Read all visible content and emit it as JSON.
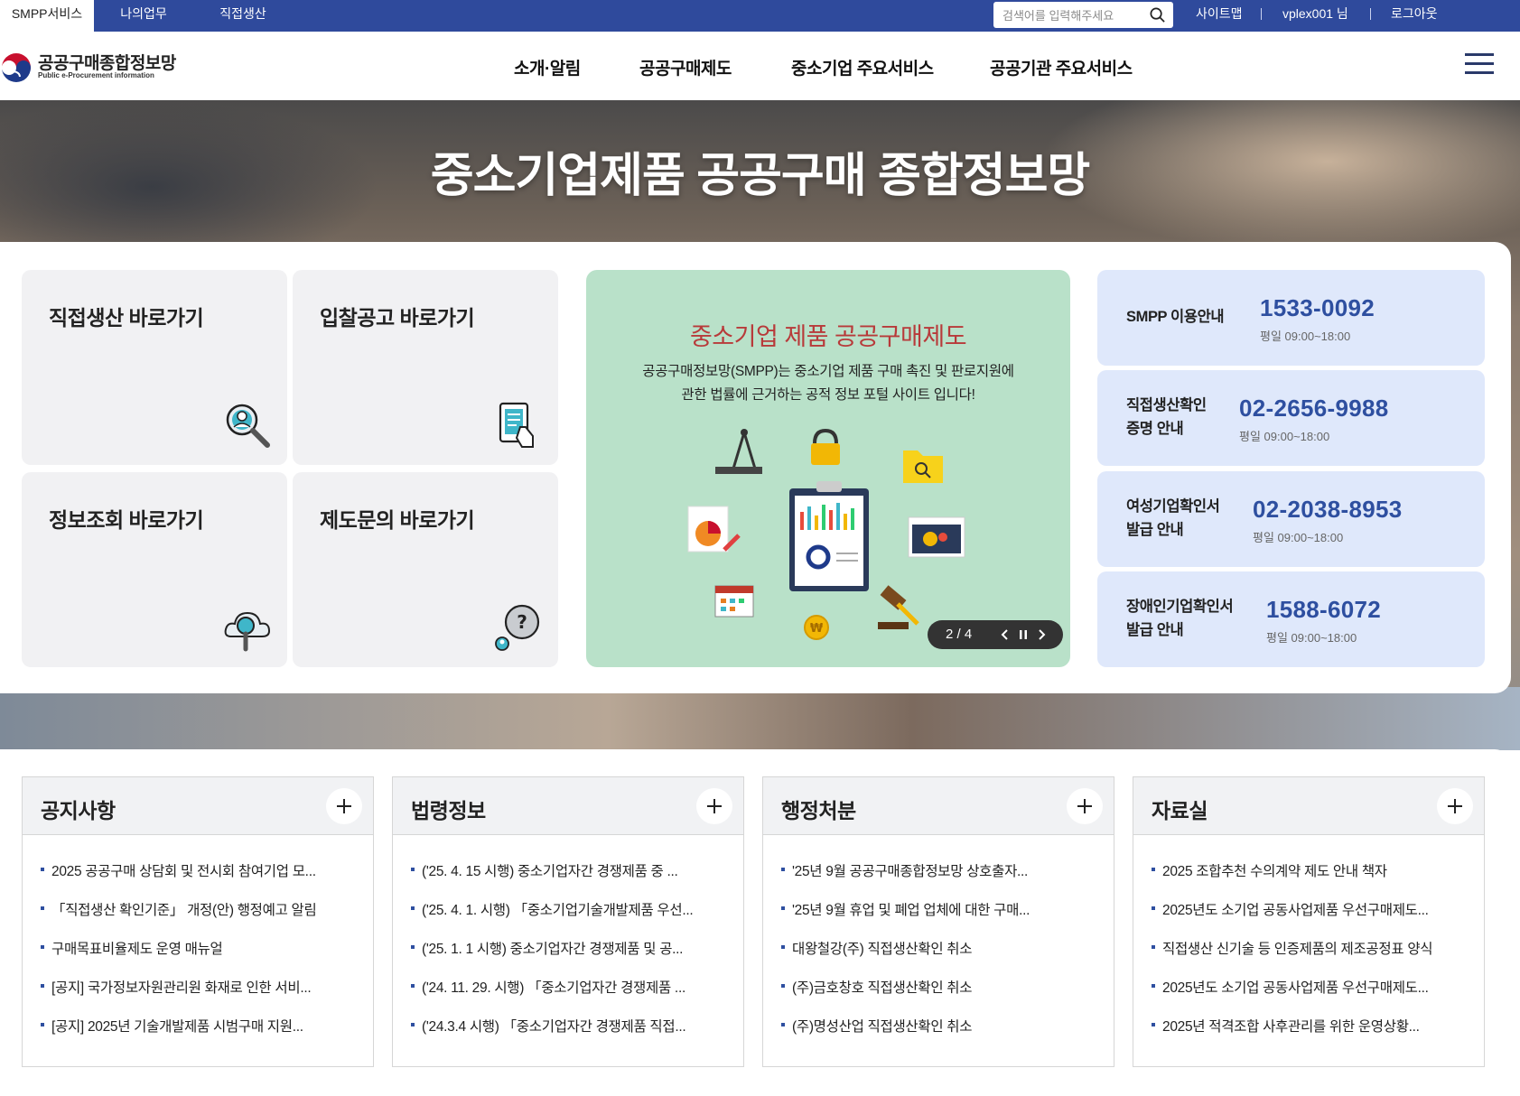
{
  "topbar": {
    "tabs": [
      "SMPP서비스",
      "나의업무",
      "직접생산"
    ],
    "search_placeholder": "검색어를 입력해주세요",
    "links": [
      "사이트맵",
      "vplex001 님",
      "로그아웃"
    ]
  },
  "header": {
    "logo_title": "공공구매종합정보망",
    "logo_subtitle": "Public e-Procurement information",
    "nav": [
      "소개·알림",
      "공공구매제도",
      "중소기업 주요서비스",
      "공공기관 주요서비스"
    ]
  },
  "hero": {
    "title": "중소기업제품 공공구매 종합정보망"
  },
  "quick_links": [
    "직접생산 바로가기",
    "입찰공고 바로가기",
    "정보조회 바로가기",
    "제도문의 바로가기"
  ],
  "banner": {
    "title": "중소기업 제품 공공구매제도",
    "desc_line1": "공공구매정보망(SMPP)는 중소기업 제품 구매 촉진 및 판로지원에",
    "desc_line2": "관한 법률에 근거하는 공적 정보 포털 사이트 입니다!",
    "pager": "2 / 4",
    "won_symbol": "₩",
    "help_symbol": "?"
  },
  "contacts": [
    {
      "label1": "SMPP 이용안내",
      "label2": "",
      "phone": "1533-0092",
      "hours": "평일 09:00~18:00"
    },
    {
      "label1": "직접생산확인",
      "label2": "증명 안내",
      "phone": "02-2656-9988",
      "hours": "평일 09:00~18:00"
    },
    {
      "label1": "여성기업확인서",
      "label2": "발급 안내",
      "phone": "02-2038-8953",
      "hours": "평일 09:00~18:00"
    },
    {
      "label1": "장애인기업확인서",
      "label2": "발급 안내",
      "phone": "1588-6072",
      "hours": "평일 09:00~18:00"
    }
  ],
  "boards": [
    {
      "title": "공지사항",
      "items": [
        "2025 공공구매 상담회 및 전시회 참여기업 모...",
        "「직접생산 확인기준」 개정(안) 행정예고 알림",
        "구매목표비율제도 운영 매뉴얼",
        "[공지] 국가정보자원관리원 화재로 인한 서비...",
        "[공지] 2025년 기술개발제품 시범구매 지원..."
      ]
    },
    {
      "title": "법령정보",
      "items": [
        "('25. 4. 15 시행) 중소기업자간 경쟁제품 중 ...",
        "('25. 4. 1. 시행) 「중소기업기술개발제품 우선...",
        "('25. 1. 1 시행) 중소기업자간 경쟁제품 및 공...",
        "('24. 11. 29. 시행) 「중소기업자간 경쟁제품 ...",
        "('24.3.4 시행) 「중소기업자간 경쟁제품 직접..."
      ]
    },
    {
      "title": "행정처분",
      "items": [
        "'25년 9월 공공구매종합정보망 상호출자...",
        "'25년 9월 휴업 및 폐업 업체에 대한 구매...",
        "대왕철강(주) 직접생산확인 취소",
        "(주)금호창호 직접생산확인 취소",
        "(주)명성산업 직접생산확인 취소"
      ]
    },
    {
      "title": "자료실",
      "items": [
        "2025 조합추천 수의계약 제도 안내 책자",
        "2025년도 소기업 공동사업제품 우선구매제도...",
        "직접생산 신기술 등 인증제품의 제조공정표 양식",
        "2025년도 소기업 공동사업제품 우선구매제도...",
        "2025년 적격조합 사후관리를 위한 운영상황..."
      ]
    }
  ],
  "colors": {
    "brand_blue": "#2f4a9c",
    "phone_blue": "#2e4fa0",
    "banner_green": "#b9e1c9",
    "banner_title_red": "#b83a3a",
    "contact_bg": "#dfe8fb"
  }
}
